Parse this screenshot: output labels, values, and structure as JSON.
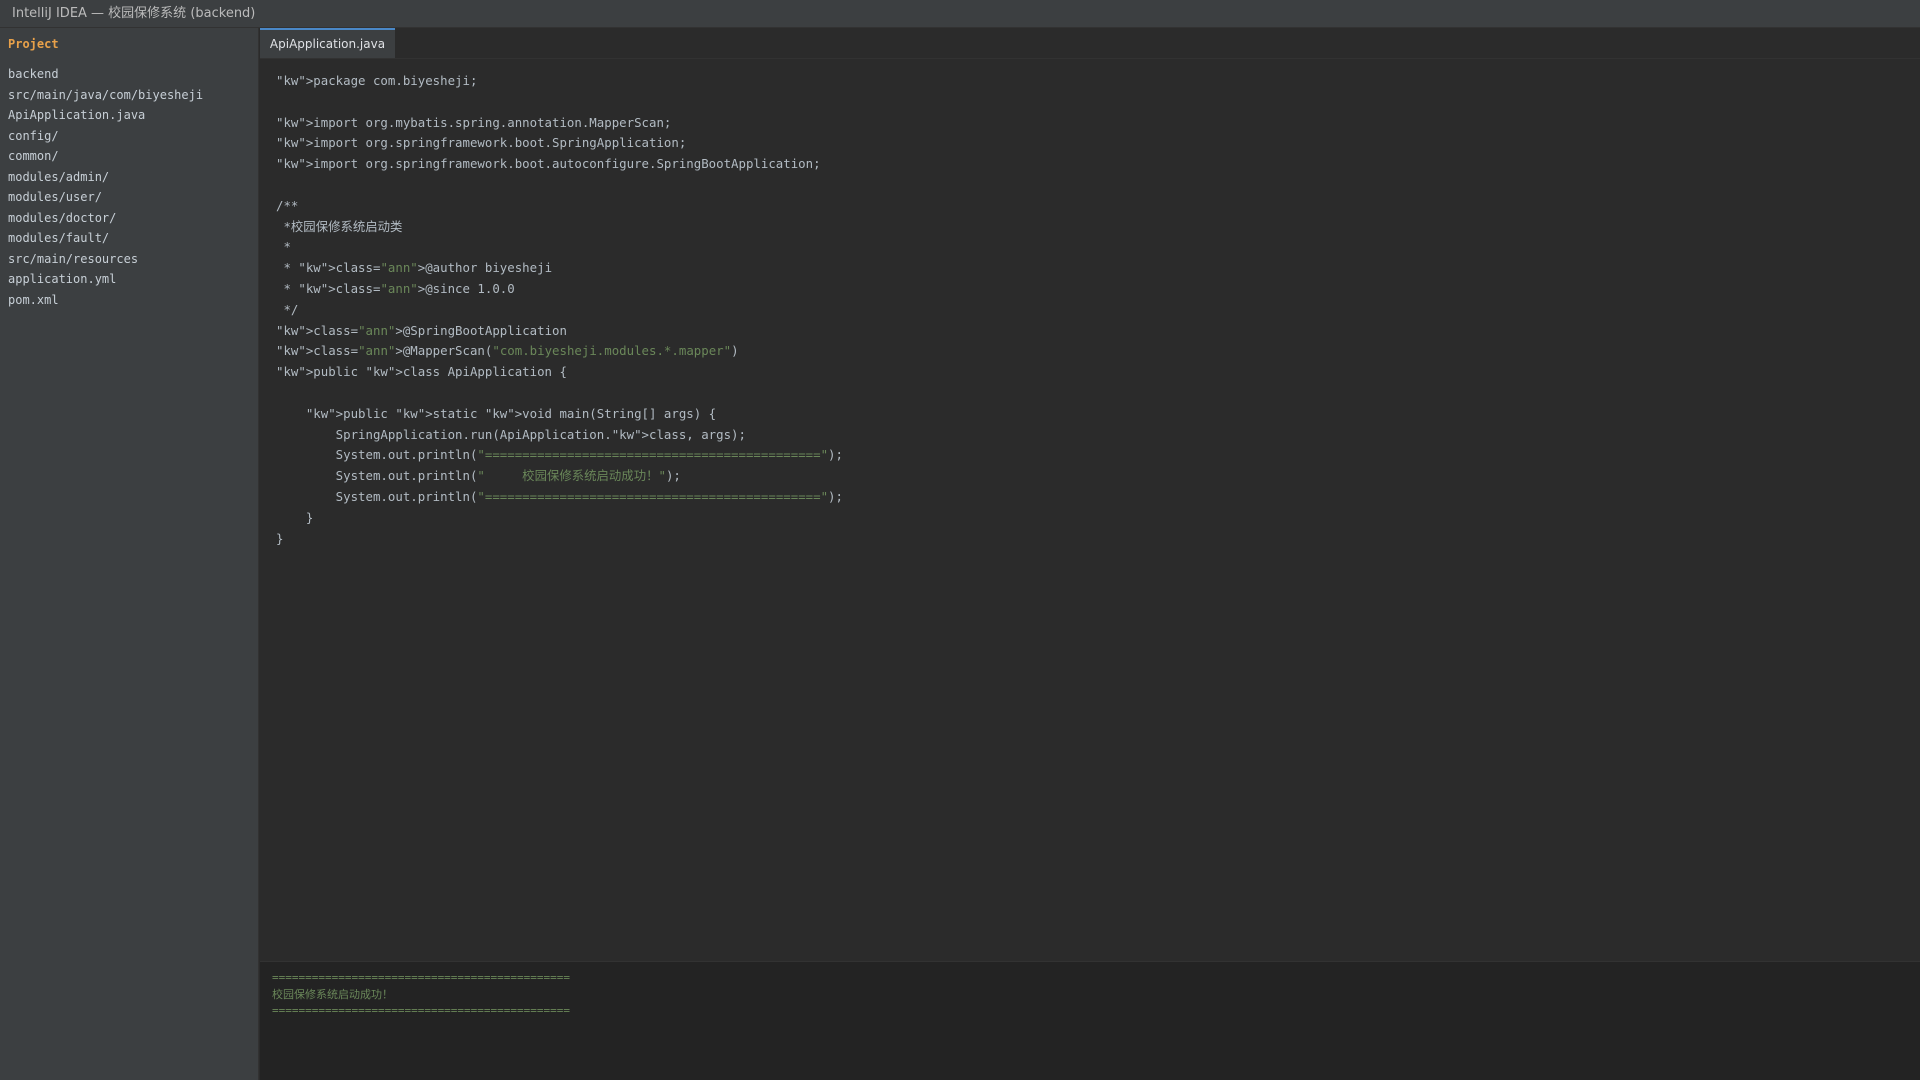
{
  "window": {
    "title": "IntelliJ IDEA — 校园保修系统 (backend)"
  },
  "sidebar": {
    "title": "Project",
    "items": [
      "backend",
      "src/main/java/com/biyesheji",
      "ApiApplication.java",
      "config/",
      "common/",
      "modules/admin/",
      "modules/user/",
      "modules/doctor/",
      "modules/fault/",
      "src/main/resources",
      "application.yml",
      "pom.xml"
    ]
  },
  "editor": {
    "tab": "ApiApplication.java",
    "lines": [
      [
        {
          "t": "\"kw\">package com.biyesheji;"
        }
      ],
      [
        {
          "t": ""
        }
      ],
      [
        {
          "t": "\"kw\">import org.mybatis.spring.annotation.MapperScan;"
        }
      ],
      [
        {
          "t": "\"kw\">import org.springframework.boot.SpringApplication;"
        }
      ],
      [
        {
          "t": "\"kw\">import org.springframework.boot.autoconfigure.SpringBootApplication;"
        }
      ],
      [
        {
          "t": ""
        }
      ],
      [
        {
          "t": "/**"
        }
      ],
      [
        {
          "t": " *校园保修系统启动类"
        }
      ],
      [
        {
          "t": " *"
        }
      ],
      [
        {
          "t": " * \"kw\">class="
        },
        {
          "t": "\"ann\"",
          "s": "str"
        },
        {
          "t": ">@author biyesheji"
        }
      ],
      [
        {
          "t": " * \"kw\">class="
        },
        {
          "t": "\"ann\"",
          "s": "str"
        },
        {
          "t": ">@since 1.0.0"
        }
      ],
      [
        {
          "t": " */"
        }
      ],
      [
        {
          "t": "\"kw\">class="
        },
        {
          "t": "\"ann\"",
          "s": "str"
        },
        {
          "t": ">@SpringBootApplication"
        }
      ],
      [
        {
          "t": "\"kw\">class="
        },
        {
          "t": "\"ann\"",
          "s": "str"
        },
        {
          "t": ">@MapperScan("
        },
        {
          "t": "\"com.biyesheji.modules.*.mapper\"",
          "s": "str"
        },
        {
          "t": ")"
        }
      ],
      [
        {
          "t": "\"kw\">public \"kw\">class ApiApplication {"
        }
      ],
      [
        {
          "t": ""
        }
      ],
      [
        {
          "t": "    \"kw\">public \"kw\">static \"kw\">void main(String[] args) {"
        }
      ],
      [
        {
          "t": "        SpringApplication.run(ApiApplication.\"kw\">class, args);"
        }
      ],
      [
        {
          "t": "        System.out.println("
        },
        {
          "t": "\"=============================================\"",
          "s": "str"
        },
        {
          "t": ");"
        }
      ],
      [
        {
          "t": "        System.out.println("
        },
        {
          "t": "\"     校园保修系统启动成功！\"",
          "s": "str"
        },
        {
          "t": ");"
        }
      ],
      [
        {
          "t": "        System.out.println("
        },
        {
          "t": "\"=============================================\"",
          "s": "str"
        },
        {
          "t": ");"
        }
      ],
      [
        {
          "t": "    }"
        }
      ],
      [
        {
          "t": "}"
        }
      ]
    ]
  },
  "console": {
    "lines": [
      "=============================================",
      "校园保修系统启动成功！",
      "============================================="
    ]
  }
}
